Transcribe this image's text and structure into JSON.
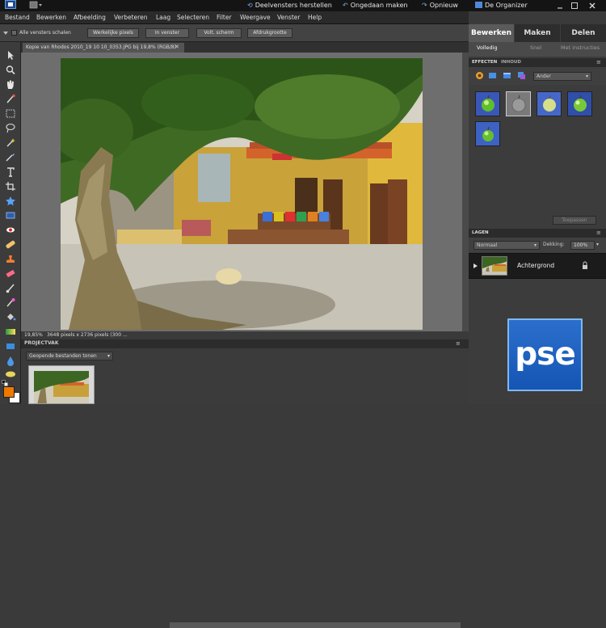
{
  "topbar": {
    "history_reset": "Deelvensters herstellen",
    "undo": "Ongedaan maken",
    "redo": "Opnieuw",
    "organizer": "De Organizer"
  },
  "menubar": {
    "items": [
      "Bestand",
      "Bewerken",
      "Afbeelding",
      "Verbeteren",
      "Laag",
      "Selecteren",
      "Filter",
      "Weergave",
      "Venster",
      "Help"
    ]
  },
  "options_bar": {
    "all_windows_label": "Alle vensters schalen",
    "buttons": [
      "Werkelijke pixels",
      "In venster",
      "Volt. scherm",
      "Afdrukgrootte"
    ]
  },
  "document": {
    "tab_title": "Kopie van Rhodos 2010_19 10 10_0353.JPG bij 19,8% (RGB/8)",
    "zoom": "19,85%",
    "size_info": "3648 pixels x 2736 pixels (300 ..."
  },
  "project_bin": {
    "title": "PROJECTVAK",
    "show_select": "Geopende bestanden tonen"
  },
  "right_panel": {
    "main_tabs": [
      "Bewerken",
      "Maken",
      "Delen"
    ],
    "sub_tabs": [
      "Volledig",
      "Snel",
      "Met instructies"
    ],
    "effects_title": "EFFECTEN",
    "content_title": "INHOUD",
    "effects_select": "Ander",
    "apply_button": "Toepassen",
    "layers_title": "LAGEN",
    "blend_mode": "Normaal",
    "opacity_label": "Dekking:",
    "opacity_value": "100%",
    "layer_name": "Achtergrond"
  },
  "badge": {
    "text": "pse"
  },
  "colors": {
    "accent": "#1e5bb8",
    "foreground_swatch": "#f07800",
    "background_swatch": "#ffffff"
  }
}
